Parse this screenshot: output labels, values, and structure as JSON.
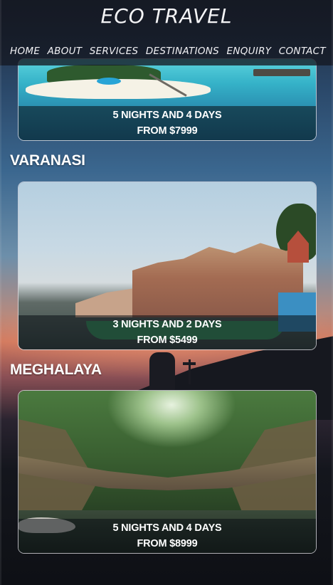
{
  "site": {
    "brand": "ECO TRAVEL"
  },
  "nav": {
    "items": [
      "HOME",
      "ABOUT",
      "SERVICES",
      "DESTINATIONS",
      "ENQUIRY",
      "CONTACT"
    ]
  },
  "cards": [
    {
      "heading": "",
      "duration": "5 NIGHTS AND 4 DAYS",
      "price": "FROM  $7999",
      "image": "tropical-island-resort"
    },
    {
      "heading": "VARANASI",
      "duration": "3 NIGHTS AND 2 DAYS",
      "price": "FROM  $5499",
      "image": "varanasi-ghats"
    },
    {
      "heading": "MEGHALAYA",
      "duration": "5 NIGHTS AND 4 DAYS",
      "price": "FROM  $8999",
      "image": "living-root-bridge"
    }
  ],
  "colors": {
    "text": "#ffffff",
    "header_bg": "#141822",
    "card_border": "#e6e6eb"
  }
}
